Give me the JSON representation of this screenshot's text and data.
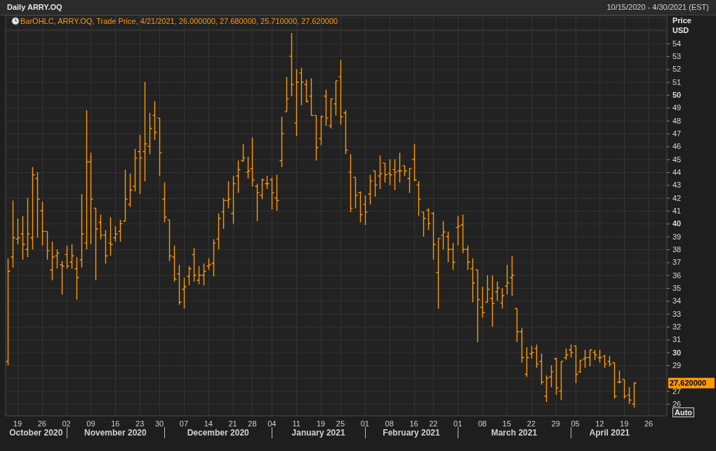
{
  "header": {
    "title": "Daily ARRY.OQ",
    "date_range": "10/15/2020 - 4/30/2021 (EST)"
  },
  "chart": {
    "legend": "BarOHLC, ARRY.OQ, Trade Price, 4/21/2021, 26.000000, 27.680000, 25.710000, 27.620000",
    "axis_title": "Price",
    "axis_unit": "USD",
    "current_price": "27.620000",
    "auto_button": "Auto",
    "y_tick_labels": [
      "54",
      "53",
      "52",
      "51",
      "50",
      "49",
      "48",
      "47",
      "46",
      "45",
      "44",
      "43",
      "42",
      "41",
      "40",
      "39",
      "38",
      "37",
      "36",
      "35",
      "34",
      "33",
      "32",
      "31",
      "30",
      "29",
      "27",
      "26"
    ],
    "x_tick_labels": [
      "19",
      "26",
      "02",
      "09",
      "16",
      "23",
      "30",
      "07",
      "14",
      "21",
      "28",
      "04",
      "11",
      "19",
      "25",
      "01",
      "08",
      "16",
      "22",
      "01",
      "08",
      "15",
      "22",
      "29",
      "05",
      "12",
      "19",
      "26"
    ],
    "months": [
      "October 2020",
      "November 2020",
      "December 2020",
      "January 2021",
      "February 2021",
      "March 2021",
      "April 2021"
    ]
  }
}
